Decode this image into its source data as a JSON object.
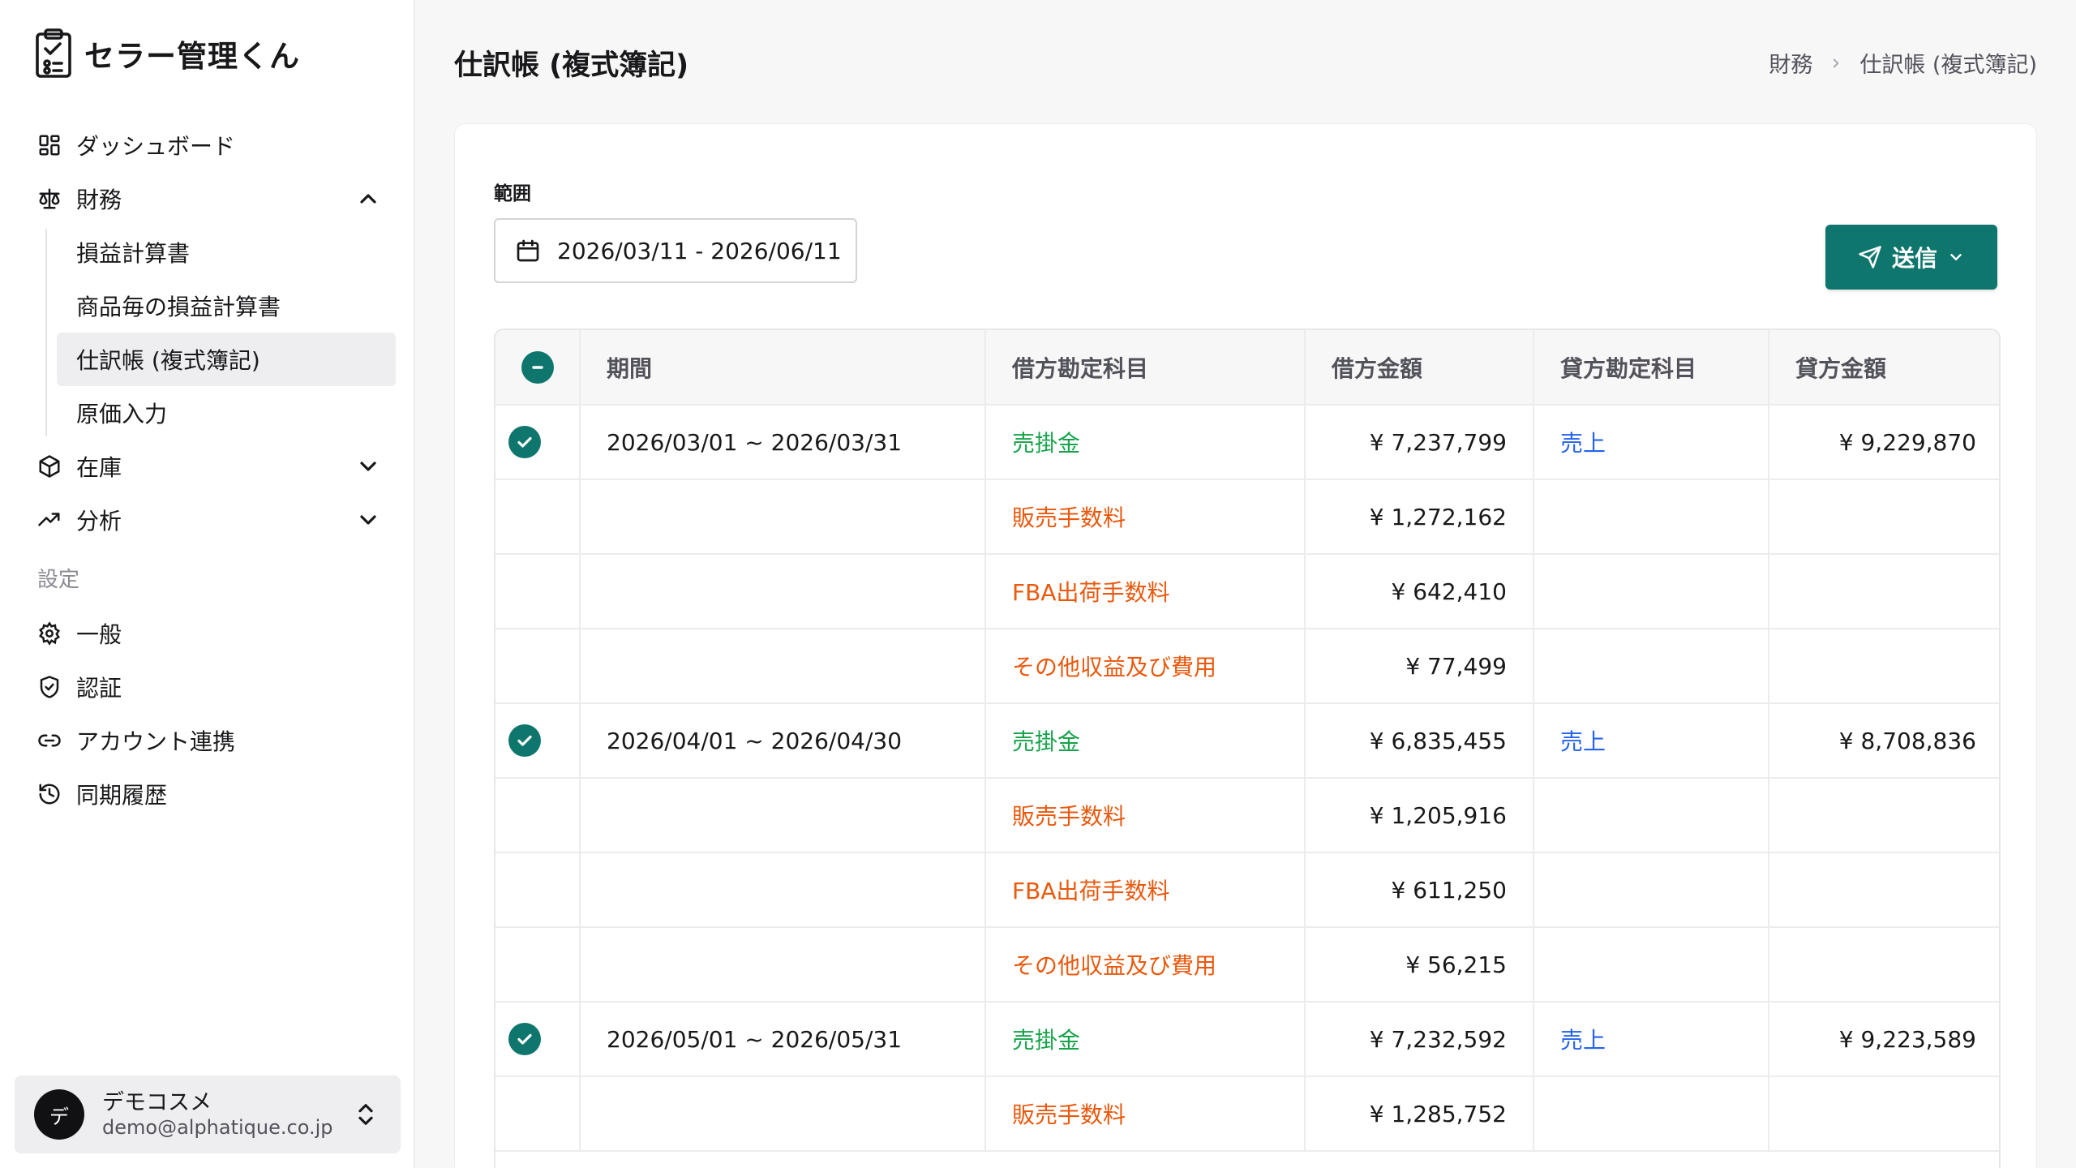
{
  "app": {
    "name": "セラー管理くん"
  },
  "sidebar": {
    "items": [
      {
        "label": "ダッシュボード"
      },
      {
        "label": "財務"
      },
      {
        "label": "在庫"
      },
      {
        "label": "分析"
      }
    ],
    "finance_sub": [
      {
        "label": "損益計算書"
      },
      {
        "label": "商品毎の損益計算書"
      },
      {
        "label": "仕訳帳 (複式簿記)"
      },
      {
        "label": "原価入力"
      }
    ],
    "settings_label": "設定",
    "settings_items": [
      {
        "label": "一般"
      },
      {
        "label": "認証"
      },
      {
        "label": "アカウント連携"
      },
      {
        "label": "同期履歴"
      }
    ],
    "user": {
      "initial": "デ",
      "name": "デモコスメ",
      "email": "demo@alphatique.co.jp"
    }
  },
  "header": {
    "title": "仕訳帳 (複式簿記)",
    "breadcrumb": [
      "財務",
      "仕訳帳 (複式簿記)"
    ]
  },
  "filters": {
    "range_label": "範囲",
    "date_range": "2026/03/11 - 2026/06/11"
  },
  "actions": {
    "send_label": "送信"
  },
  "table": {
    "columns": [
      "期間",
      "借方勘定科目",
      "借方金額",
      "貸方勘定科目",
      "貸方金額"
    ],
    "rows": [
      {
        "period": "2026/03/01 ~ 2026/03/31",
        "debit_account": "売掛金",
        "debit_type": "green",
        "debit_amount": "¥ 7,237,799",
        "credit_account": "売上",
        "credit_amount": "¥ 9,229,870",
        "checked": true
      },
      {
        "period": "",
        "debit_account": "販売手数料",
        "debit_type": "orange",
        "debit_amount": "¥ 1,272,162",
        "credit_account": "",
        "credit_amount": "",
        "checked": false
      },
      {
        "period": "",
        "debit_account": "FBA出荷手数料",
        "debit_type": "orange",
        "debit_amount": "¥ 642,410",
        "credit_account": "",
        "credit_amount": "",
        "checked": false
      },
      {
        "period": "",
        "debit_account": "その他収益及び費用",
        "debit_type": "orange",
        "debit_amount": "¥ 77,499",
        "credit_account": "",
        "credit_amount": "",
        "checked": false
      },
      {
        "period": "2026/04/01 ~ 2026/04/30",
        "debit_account": "売掛金",
        "debit_type": "green",
        "debit_amount": "¥ 6,835,455",
        "credit_account": "売上",
        "credit_amount": "¥ 8,708,836",
        "checked": true
      },
      {
        "period": "",
        "debit_account": "販売手数料",
        "debit_type": "orange",
        "debit_amount": "¥ 1,205,916",
        "credit_account": "",
        "credit_amount": "",
        "checked": false
      },
      {
        "period": "",
        "debit_account": "FBA出荷手数料",
        "debit_type": "orange",
        "debit_amount": "¥ 611,250",
        "credit_account": "",
        "credit_amount": "",
        "checked": false
      },
      {
        "period": "",
        "debit_account": "その他収益及び費用",
        "debit_type": "orange",
        "debit_amount": "¥ 56,215",
        "credit_account": "",
        "credit_amount": "",
        "checked": false
      },
      {
        "period": "2026/05/01 ~ 2026/05/31",
        "debit_account": "売掛金",
        "debit_type": "green",
        "debit_amount": "¥ 7,232,592",
        "credit_account": "売上",
        "credit_amount": "¥ 9,223,589",
        "checked": true
      },
      {
        "period": "",
        "debit_account": "販売手数料",
        "debit_type": "orange",
        "debit_amount": "¥ 1,285,752",
        "credit_account": "",
        "credit_amount": "",
        "checked": false
      }
    ]
  },
  "colors": {
    "accent": "#0f766e",
    "debit_green": "#16a34a",
    "debit_orange": "#ea580c",
    "credit_blue": "#2563eb"
  }
}
